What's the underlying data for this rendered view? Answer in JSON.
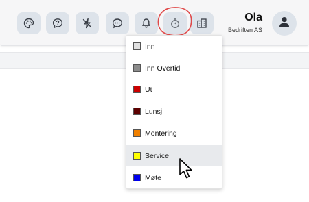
{
  "header": {
    "user": {
      "name": "Ola",
      "company": "Bedriften AS"
    },
    "toolbar": [
      {
        "icon": "palette-icon"
      },
      {
        "icon": "help-icon"
      },
      {
        "icon": "flash-off-icon"
      },
      {
        "icon": "chat-icon"
      },
      {
        "icon": "bell-icon"
      },
      {
        "icon": "stopwatch-icon"
      },
      {
        "icon": "building-icon"
      }
    ]
  },
  "status_menu": {
    "items": [
      {
        "label": "Inn",
        "color": "#e0e0e0"
      },
      {
        "label": "Inn Overtid",
        "color": "#8c8c8c"
      },
      {
        "label": "Ut",
        "color": "#cc0000"
      },
      {
        "label": "Lunsj",
        "color": "#5c0000"
      },
      {
        "label": "Montering",
        "color": "#f08000"
      },
      {
        "label": "Service",
        "color": "#ffff00"
      },
      {
        "label": "Møte",
        "color": "#0000ee"
      }
    ],
    "hovered_item": "Service"
  },
  "colors": {
    "button_bg": "#dde3ea",
    "icon": "#3a3f47",
    "highlight_ring": "#e04a4a"
  }
}
